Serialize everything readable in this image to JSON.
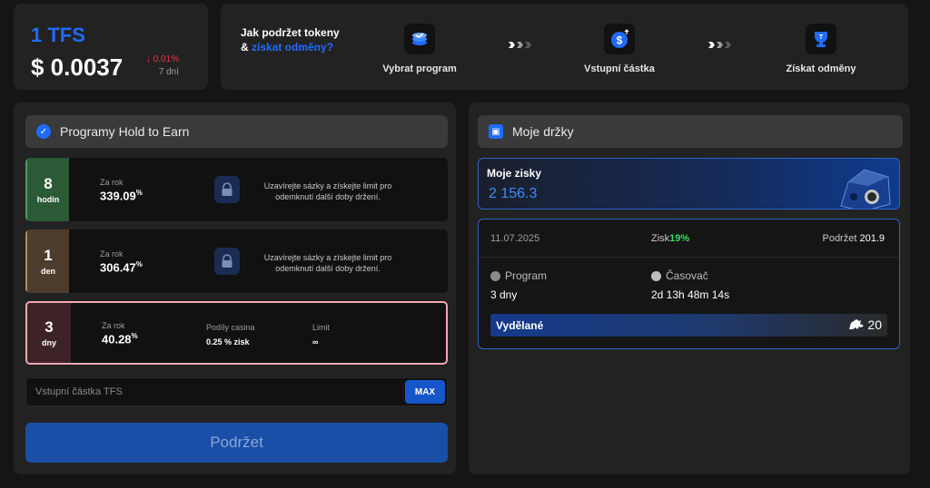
{
  "price": {
    "token": "1 TFS",
    "value": "$ 0.0037",
    "change": "0.01%",
    "change_arrow": "↓",
    "period": "7 dní",
    "accent_color": "#1f6bff",
    "down_color": "#e23838"
  },
  "howto": {
    "question_part1": "Jak podržet tokeny & ",
    "question_highlight": "získat odměny?",
    "steps": [
      {
        "label": "Vybrat program",
        "icon": "stack-check-icon"
      },
      {
        "label": "Vstupní částka",
        "icon": "dollar-coin-icon"
      },
      {
        "label": "Získat odměny",
        "icon": "trophy-icon"
      }
    ]
  },
  "programs": {
    "title": "Programy Hold to Earn",
    "rate_label": "Za rok",
    "lock_text": "Uzavírejte sázky a získejte limit pro odemknutí další doby držení.",
    "items": [
      {
        "num": "8",
        "unit": "hodin",
        "rate": "339.09",
        "locked": true,
        "accent": "#2b5a36",
        "border": "#43a35a"
      },
      {
        "num": "1",
        "unit": "den",
        "rate": "306.47",
        "locked": true,
        "accent": "#4e3c2d",
        "border": "#b38a62"
      },
      {
        "num": "3",
        "unit": "dny",
        "rate": "40.28",
        "locked": false,
        "accent": "#3d2328",
        "border": "#f2a7b5",
        "share_label": "Podíly casina",
        "share_value": "0.25 % zisk",
        "limit_label": "Limit",
        "limit_value": "∞"
      }
    ],
    "amount_placeholder": "Vstupní částka TFS",
    "max_label": "MAX",
    "hold_label": "Podržet"
  },
  "holdings": {
    "title": "Moje držky",
    "earnings_title": "Moje zisky",
    "earnings_value": "2 156.3",
    "entry": {
      "date": "11.07.2025",
      "profit_label": "Zisk",
      "profit_value": "19%",
      "held_label": "Podržet",
      "held_value": "201.9",
      "program_label": "Program",
      "program_value": "3 dny",
      "timer_label": "Časovač",
      "timer_value": "2d 13h 48m 14s",
      "earned_label": "Vydělané",
      "earned_value": "20"
    }
  }
}
